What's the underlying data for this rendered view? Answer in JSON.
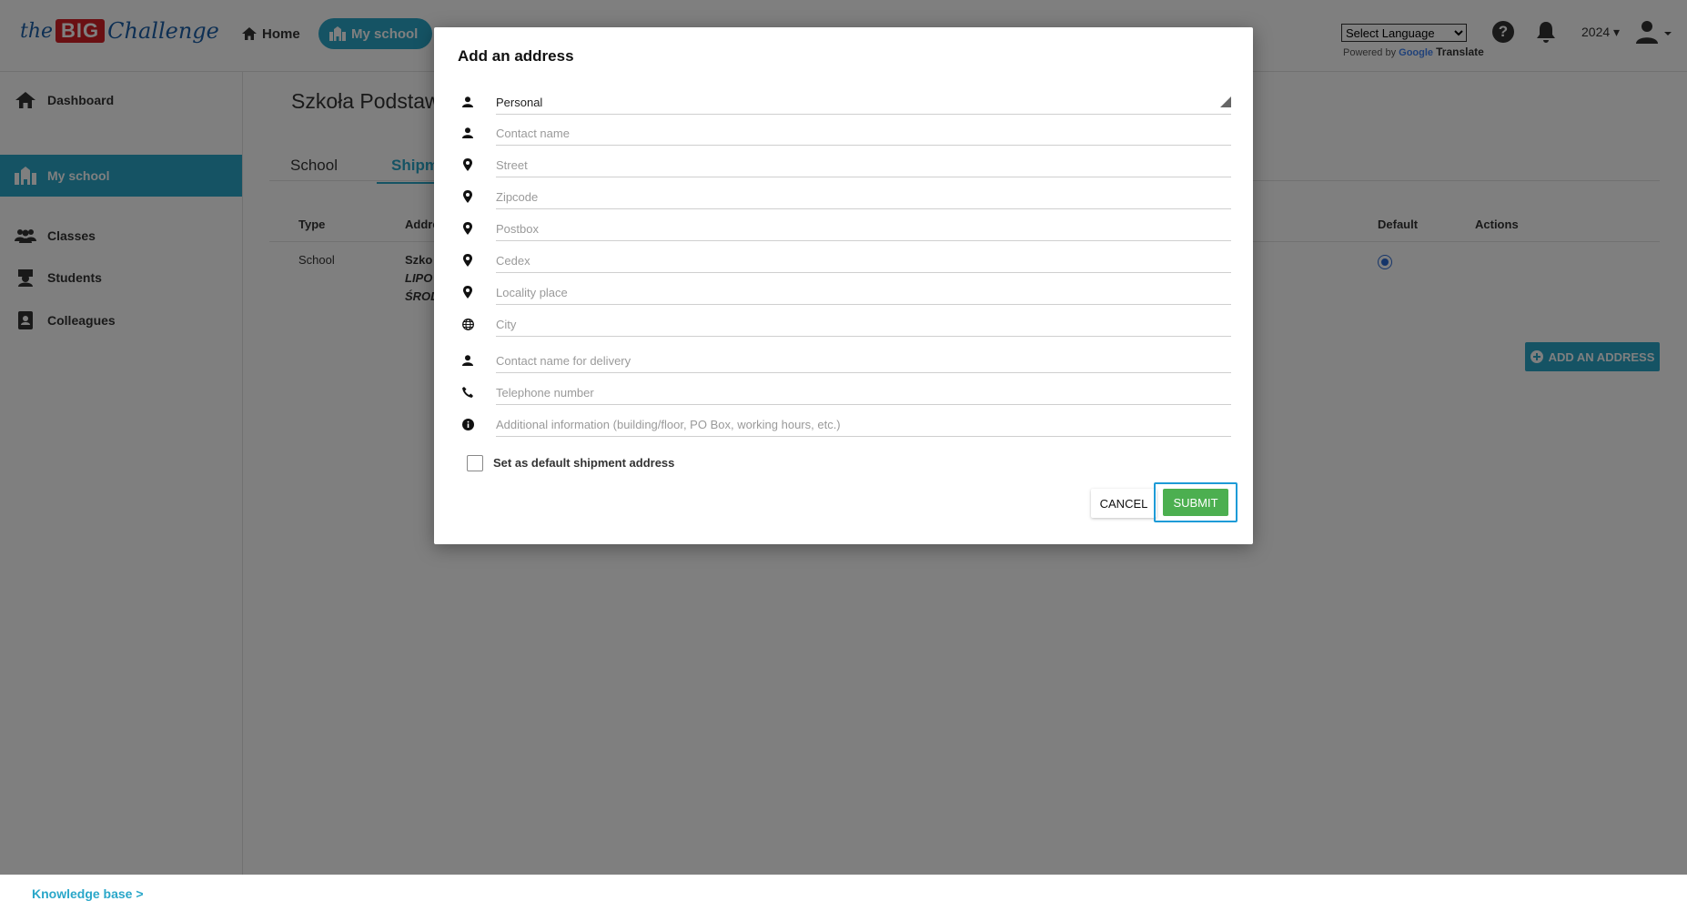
{
  "header": {
    "logo": {
      "the": "the",
      "big": "BIG",
      "challenge": "Challenge"
    },
    "nav": {
      "home": "Home",
      "my_school": "My school"
    },
    "language": {
      "selected": "Select Language",
      "powered_prefix": "Powered by",
      "google": "Google",
      "translate": "Translate"
    },
    "year": "2024",
    "icons": {
      "help": "question-icon",
      "notifications": "bell-icon",
      "user": "user-icon"
    }
  },
  "sidebar": {
    "items": [
      {
        "label": "Dashboard",
        "icon": "home-icon"
      },
      {
        "label": "My school",
        "icon": "school-icon",
        "active": true
      },
      {
        "label": "Classes",
        "icon": "users-icon"
      },
      {
        "label": "Students",
        "icon": "student-icon"
      },
      {
        "label": "Colleagues",
        "icon": "contact-book-icon"
      }
    ],
    "knowledge_base": "Knowledge base >"
  },
  "main": {
    "title": "Szkoła Podstaw",
    "tabs": [
      {
        "label": "School"
      },
      {
        "label": "Shipm",
        "active": true
      }
    ],
    "table": {
      "headers": [
        "Type",
        "Addre",
        "Default",
        "Actions"
      ],
      "row": {
        "type": "School",
        "addr_line1": "Szko",
        "addr_line2": "LIPO",
        "addr_line3": "ŚROD",
        "default": true
      }
    },
    "add_address_button": "ADD AN ADDRESS"
  },
  "modal": {
    "title": "Add an address",
    "address_type": {
      "value": "Personal",
      "icon": "person-icon"
    },
    "fields": [
      {
        "placeholder": "Contact name",
        "icon": "person-icon",
        "value": ""
      },
      {
        "placeholder": "Street",
        "icon": "map-pin-icon",
        "value": ""
      },
      {
        "placeholder": "Zipcode",
        "icon": "map-pin-icon",
        "value": ""
      },
      {
        "placeholder": "Postbox",
        "icon": "map-pin-icon",
        "value": ""
      },
      {
        "placeholder": "Cedex",
        "icon": "map-pin-icon",
        "value": ""
      },
      {
        "placeholder": "Locality place",
        "icon": "map-pin-icon",
        "value": ""
      },
      {
        "placeholder": "City",
        "icon": "globe-icon",
        "value": ""
      },
      {
        "placeholder": "Contact name for delivery",
        "icon": "person-icon",
        "value": ""
      },
      {
        "placeholder": "Telephone number",
        "icon": "phone-icon",
        "value": ""
      },
      {
        "placeholder": "Additional information (building/floor, PO Box, working hours, etc.)",
        "icon": "info-icon",
        "value": ""
      }
    ],
    "default_checkbox": {
      "label": "Set as default shipment address",
      "checked": false
    },
    "cancel": "CANCEL",
    "submit": "SUBMIT"
  },
  "colors": {
    "accent": "#2aa7c9",
    "submit": "#4caf50",
    "brand_red": "#d42027",
    "overlay": "rgba(0,0,0,0.5)"
  }
}
